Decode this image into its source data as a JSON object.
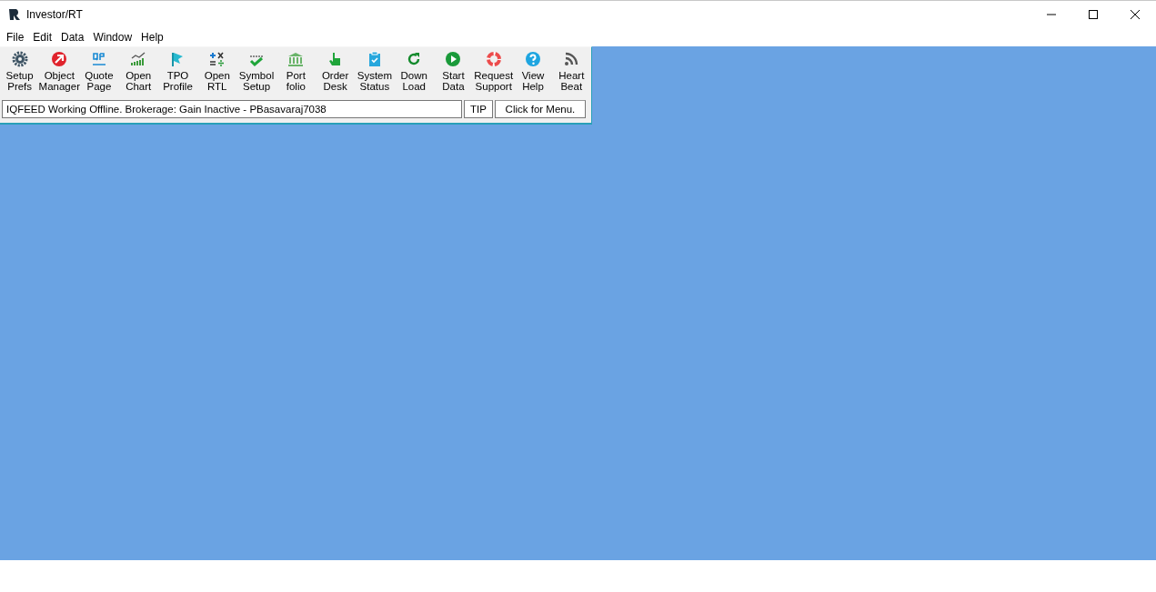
{
  "window": {
    "title": "Investor/RT"
  },
  "menu": [
    "File",
    "Edit",
    "Data",
    "Window",
    "Help"
  ],
  "toolbar": [
    {
      "label": "Setup Prefs"
    },
    {
      "label": "Object Manager"
    },
    {
      "label": "Quote Page"
    },
    {
      "label": "Open Chart"
    },
    {
      "label": "TPO Profile"
    },
    {
      "label": "Open RTL"
    },
    {
      "label": "Symbol Setup"
    },
    {
      "label": "Port folio"
    },
    {
      "label": "Order Desk"
    },
    {
      "label": "System Status"
    },
    {
      "label": "Down Load"
    },
    {
      "label": "Start Data"
    },
    {
      "label": "Request Support"
    },
    {
      "label": "View Help"
    },
    {
      "label": "Heart Beat"
    }
  ],
  "status_bar": {
    "message": "IQFEED Working Offline. Brokerage: Gain Inactive - PBasavaraj7038",
    "tip": "TIP",
    "menu_button": "Click for Menu."
  }
}
